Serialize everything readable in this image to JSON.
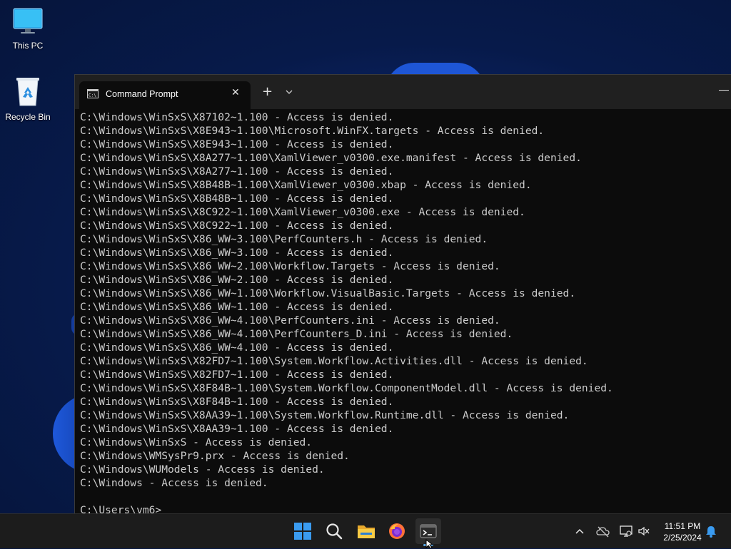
{
  "desktop": {
    "icons": [
      {
        "label": "This PC"
      },
      {
        "label": "Recycle Bin"
      }
    ]
  },
  "window": {
    "tab_title": "Command Prompt",
    "tab_icon": "cmd-icon",
    "close_glyph": "✕",
    "new_tab_glyph": "+"
  },
  "terminal": {
    "lines": [
      "C:\\Windows\\WinSxS\\X87102~1.100 - Access is denied.",
      "C:\\Windows\\WinSxS\\X8E943~1.100\\Microsoft.WinFX.targets - Access is denied.",
      "C:\\Windows\\WinSxS\\X8E943~1.100 - Access is denied.",
      "C:\\Windows\\WinSxS\\X8A277~1.100\\XamlViewer_v0300.exe.manifest - Access is denied.",
      "C:\\Windows\\WinSxS\\X8A277~1.100 - Access is denied.",
      "C:\\Windows\\WinSxS\\X8B48B~1.100\\XamlViewer_v0300.xbap - Access is denied.",
      "C:\\Windows\\WinSxS\\X8B48B~1.100 - Access is denied.",
      "C:\\Windows\\WinSxS\\X8C922~1.100\\XamlViewer_v0300.exe - Access is denied.",
      "C:\\Windows\\WinSxS\\X8C922~1.100 - Access is denied.",
      "C:\\Windows\\WinSxS\\X86_WW~3.100\\PerfCounters.h - Access is denied.",
      "C:\\Windows\\WinSxS\\X86_WW~3.100 - Access is denied.",
      "C:\\Windows\\WinSxS\\X86_WW~2.100\\Workflow.Targets - Access is denied.",
      "C:\\Windows\\WinSxS\\X86_WW~2.100 - Access is denied.",
      "C:\\Windows\\WinSxS\\X86_WW~1.100\\Workflow.VisualBasic.Targets - Access is denied.",
      "C:\\Windows\\WinSxS\\X86_WW~1.100 - Access is denied.",
      "C:\\Windows\\WinSxS\\X86_WW~4.100\\PerfCounters.ini - Access is denied.",
      "C:\\Windows\\WinSxS\\X86_WW~4.100\\PerfCounters_D.ini - Access is denied.",
      "C:\\Windows\\WinSxS\\X86_WW~4.100 - Access is denied.",
      "C:\\Windows\\WinSxS\\X82FD7~1.100\\System.Workflow.Activities.dll - Access is denied.",
      "C:\\Windows\\WinSxS\\X82FD7~1.100 - Access is denied.",
      "C:\\Windows\\WinSxS\\X8F84B~1.100\\System.Workflow.ComponentModel.dll - Access is denied.",
      "C:\\Windows\\WinSxS\\X8F84B~1.100 - Access is denied.",
      "C:\\Windows\\WinSxS\\X8AA39~1.100\\System.Workflow.Runtime.dll - Access is denied.",
      "C:\\Windows\\WinSxS\\X8AA39~1.100 - Access is denied.",
      "C:\\Windows\\WinSxS - Access is denied.",
      "C:\\Windows\\WMSysPr9.prx - Access is denied.",
      "C:\\Windows\\WUModels - Access is denied.",
      "C:\\Windows - Access is denied.",
      "",
      "C:\\Users\\vm6>"
    ]
  },
  "taskbar": {
    "pinned": [
      {
        "icon": "windows-start-icon",
        "color": "#3a9bf0"
      },
      {
        "icon": "search-icon"
      },
      {
        "icon": "file-explorer-icon",
        "color": "#f5c33b"
      },
      {
        "icon": "firefox-icon",
        "color": "#ff7139"
      },
      {
        "icon": "terminal-icon"
      }
    ],
    "tray_icons": [
      "chevron-up-icon",
      "onedrive-icon",
      "network-icon",
      "volume-muted-icon"
    ],
    "clock": {
      "time": "11:51 PM",
      "date": "2/25/2024"
    },
    "notification_icon": "notification-bell-icon"
  }
}
